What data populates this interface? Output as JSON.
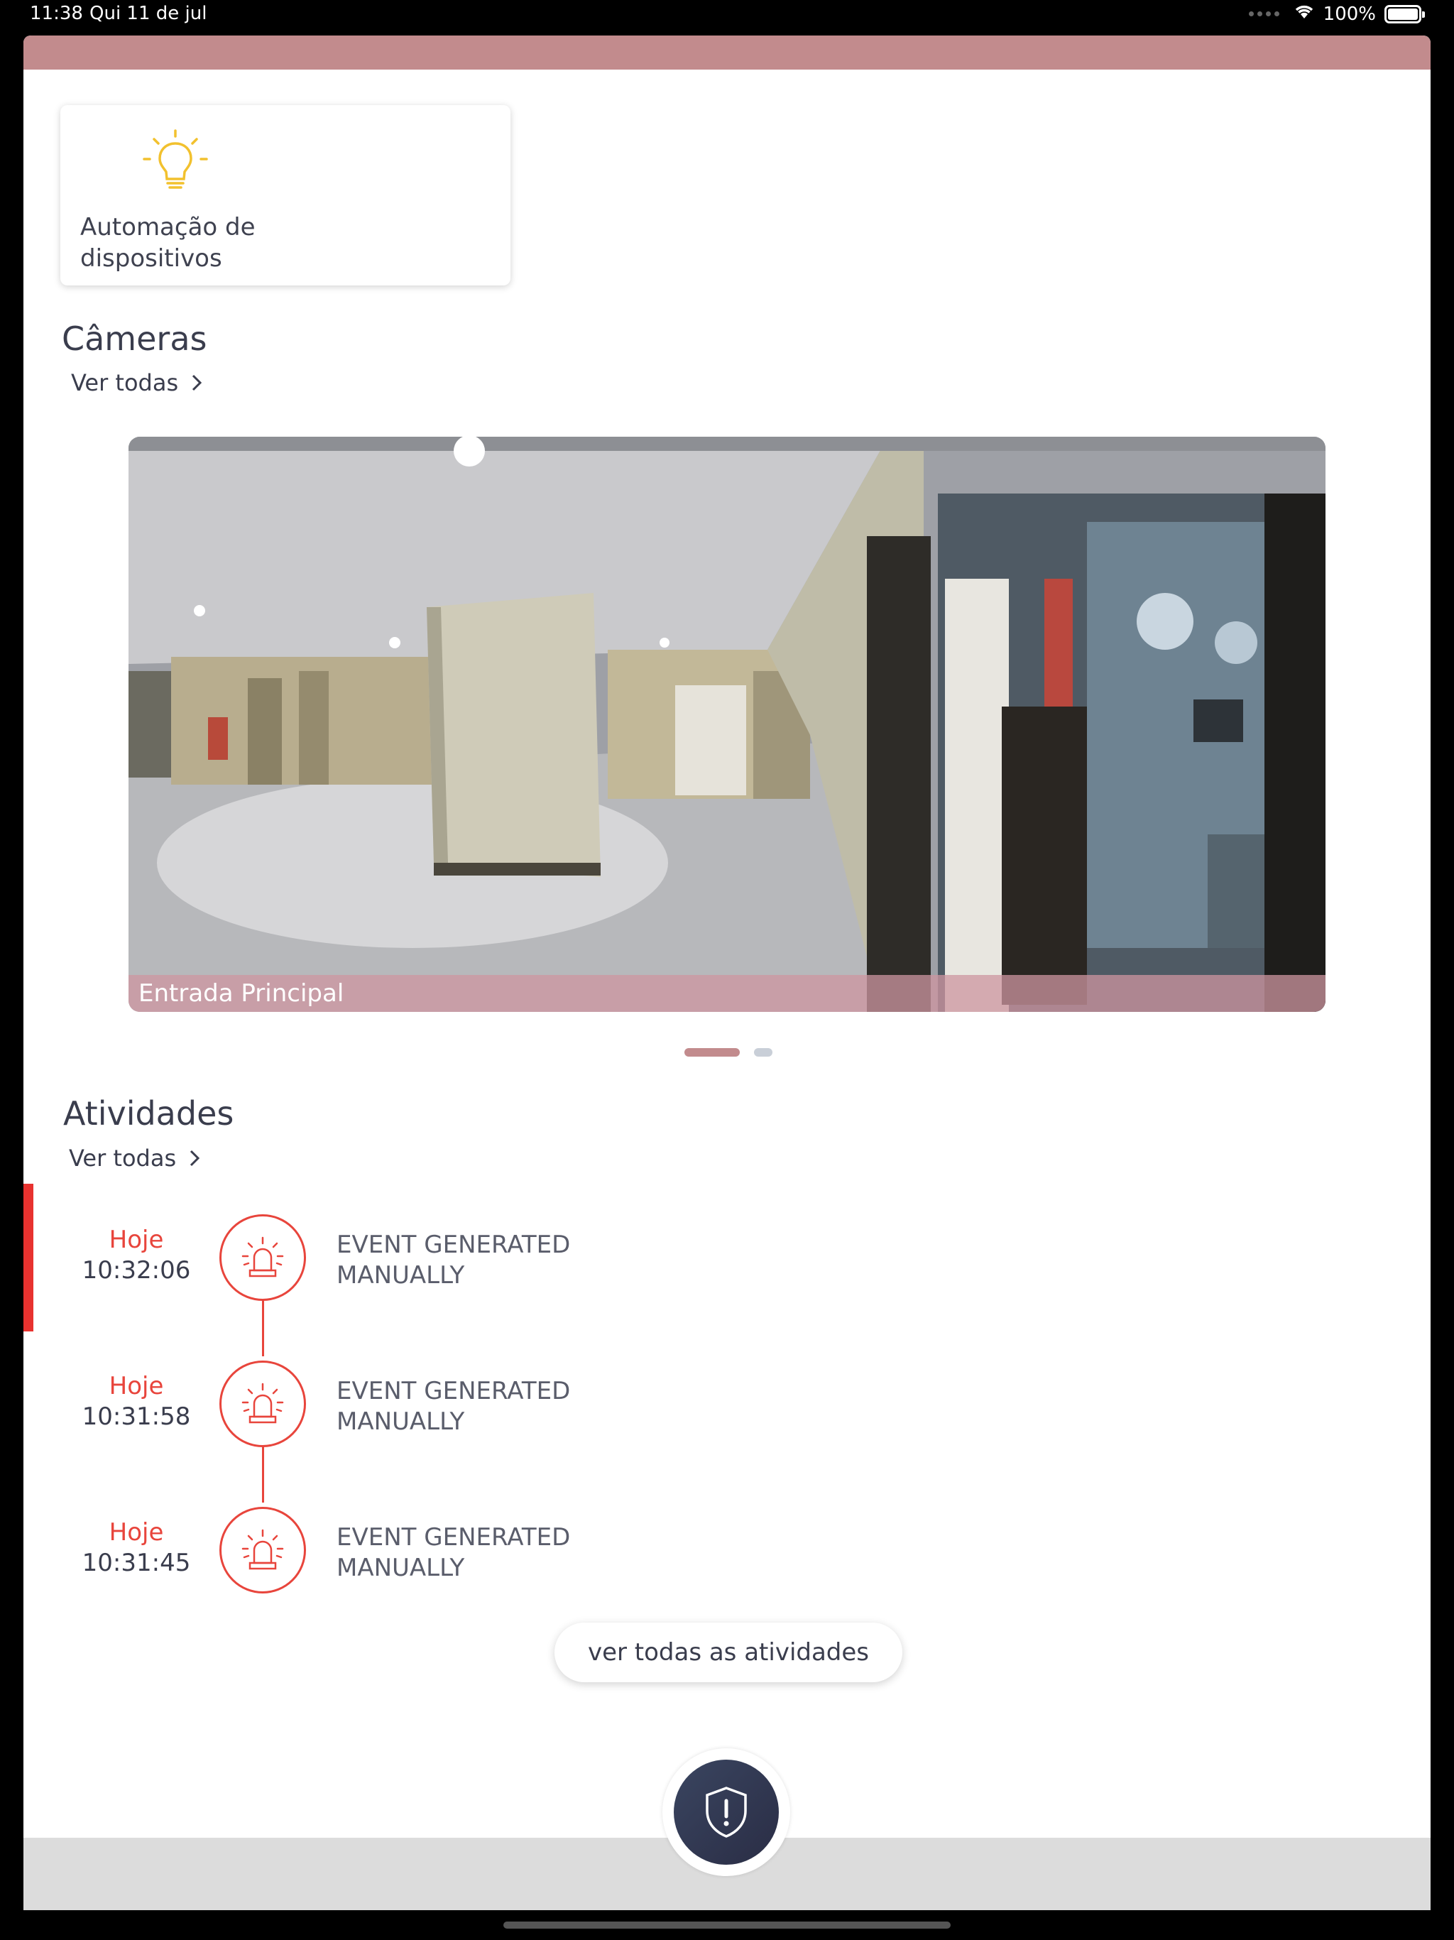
{
  "status_bar": {
    "time": "11:38",
    "date": "Qui 11 de jul",
    "battery": "100%"
  },
  "automation_card": {
    "label": "Automação de dispositivos",
    "icon": "lightbulb-icon",
    "icon_color": "#f2c12e"
  },
  "cameras": {
    "title": "Câmeras",
    "see_all": "Ver todas",
    "items": [
      {
        "name": "Entrada Principal"
      }
    ],
    "page_count": 2,
    "active_page": 1
  },
  "activities": {
    "title": "Atividades",
    "see_all": "Ver todas",
    "items": [
      {
        "day": "Hoje",
        "time": "10:32:06",
        "line1": "EVENT GENERATED",
        "line2": "MANUALLY",
        "icon": "alarm-siren-icon"
      },
      {
        "day": "Hoje",
        "time": "10:31:58",
        "line1": "EVENT GENERATED",
        "line2": "MANUALLY",
        "icon": "alarm-siren-icon"
      },
      {
        "day": "Hoje",
        "time": "10:31:45",
        "line1": "EVENT GENERATED",
        "line2": "MANUALLY",
        "icon": "alarm-siren-icon"
      }
    ],
    "view_all_button": "ver todas as atividades"
  },
  "fab": {
    "icon": "shield-alert-icon"
  },
  "colors": {
    "brand": "#c28b8d",
    "alert": "#e8453c",
    "text": "#3a3d4d"
  }
}
